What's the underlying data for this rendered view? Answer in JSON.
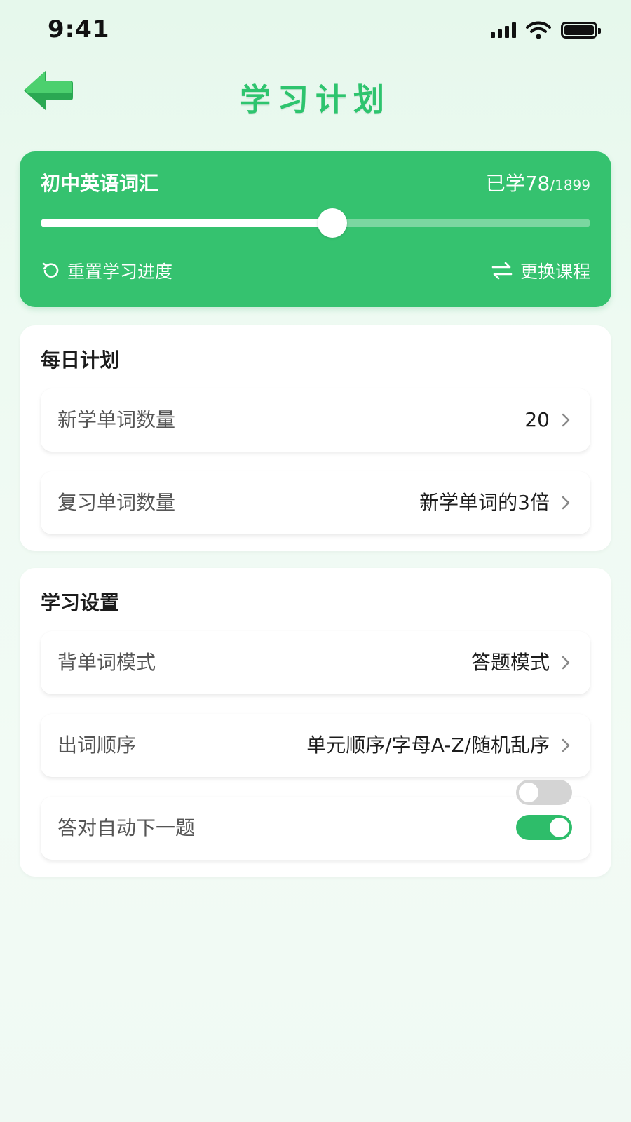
{
  "status_bar": {
    "time": "9:41"
  },
  "header": {
    "title": "学习计划"
  },
  "course": {
    "name": "初中英语词汇",
    "learned_prefix": "已学",
    "learned": "78",
    "total": "/1899",
    "progress_fraction": 0.53,
    "reset_label": "重置学习进度",
    "switch_label": "更换课程"
  },
  "daily_plan": {
    "title": "每日计划",
    "rows": [
      {
        "label": "新学单词数量",
        "value": "20"
      },
      {
        "label": "复习单词数量",
        "value": "新学单词的3倍"
      }
    ]
  },
  "study_settings": {
    "title": "学习设置",
    "rows": [
      {
        "label": "背单词模式",
        "value": "答题模式"
      },
      {
        "label": "出词顺序",
        "value": "单元顺序/字母A-Z/随机乱序"
      }
    ],
    "auto_next": {
      "label": "答对自动下一题",
      "enabled": true
    }
  },
  "colors": {
    "accent": "#35c26f",
    "title_green": "#2ec46e",
    "toggle_on": "#2ebd6a"
  }
}
